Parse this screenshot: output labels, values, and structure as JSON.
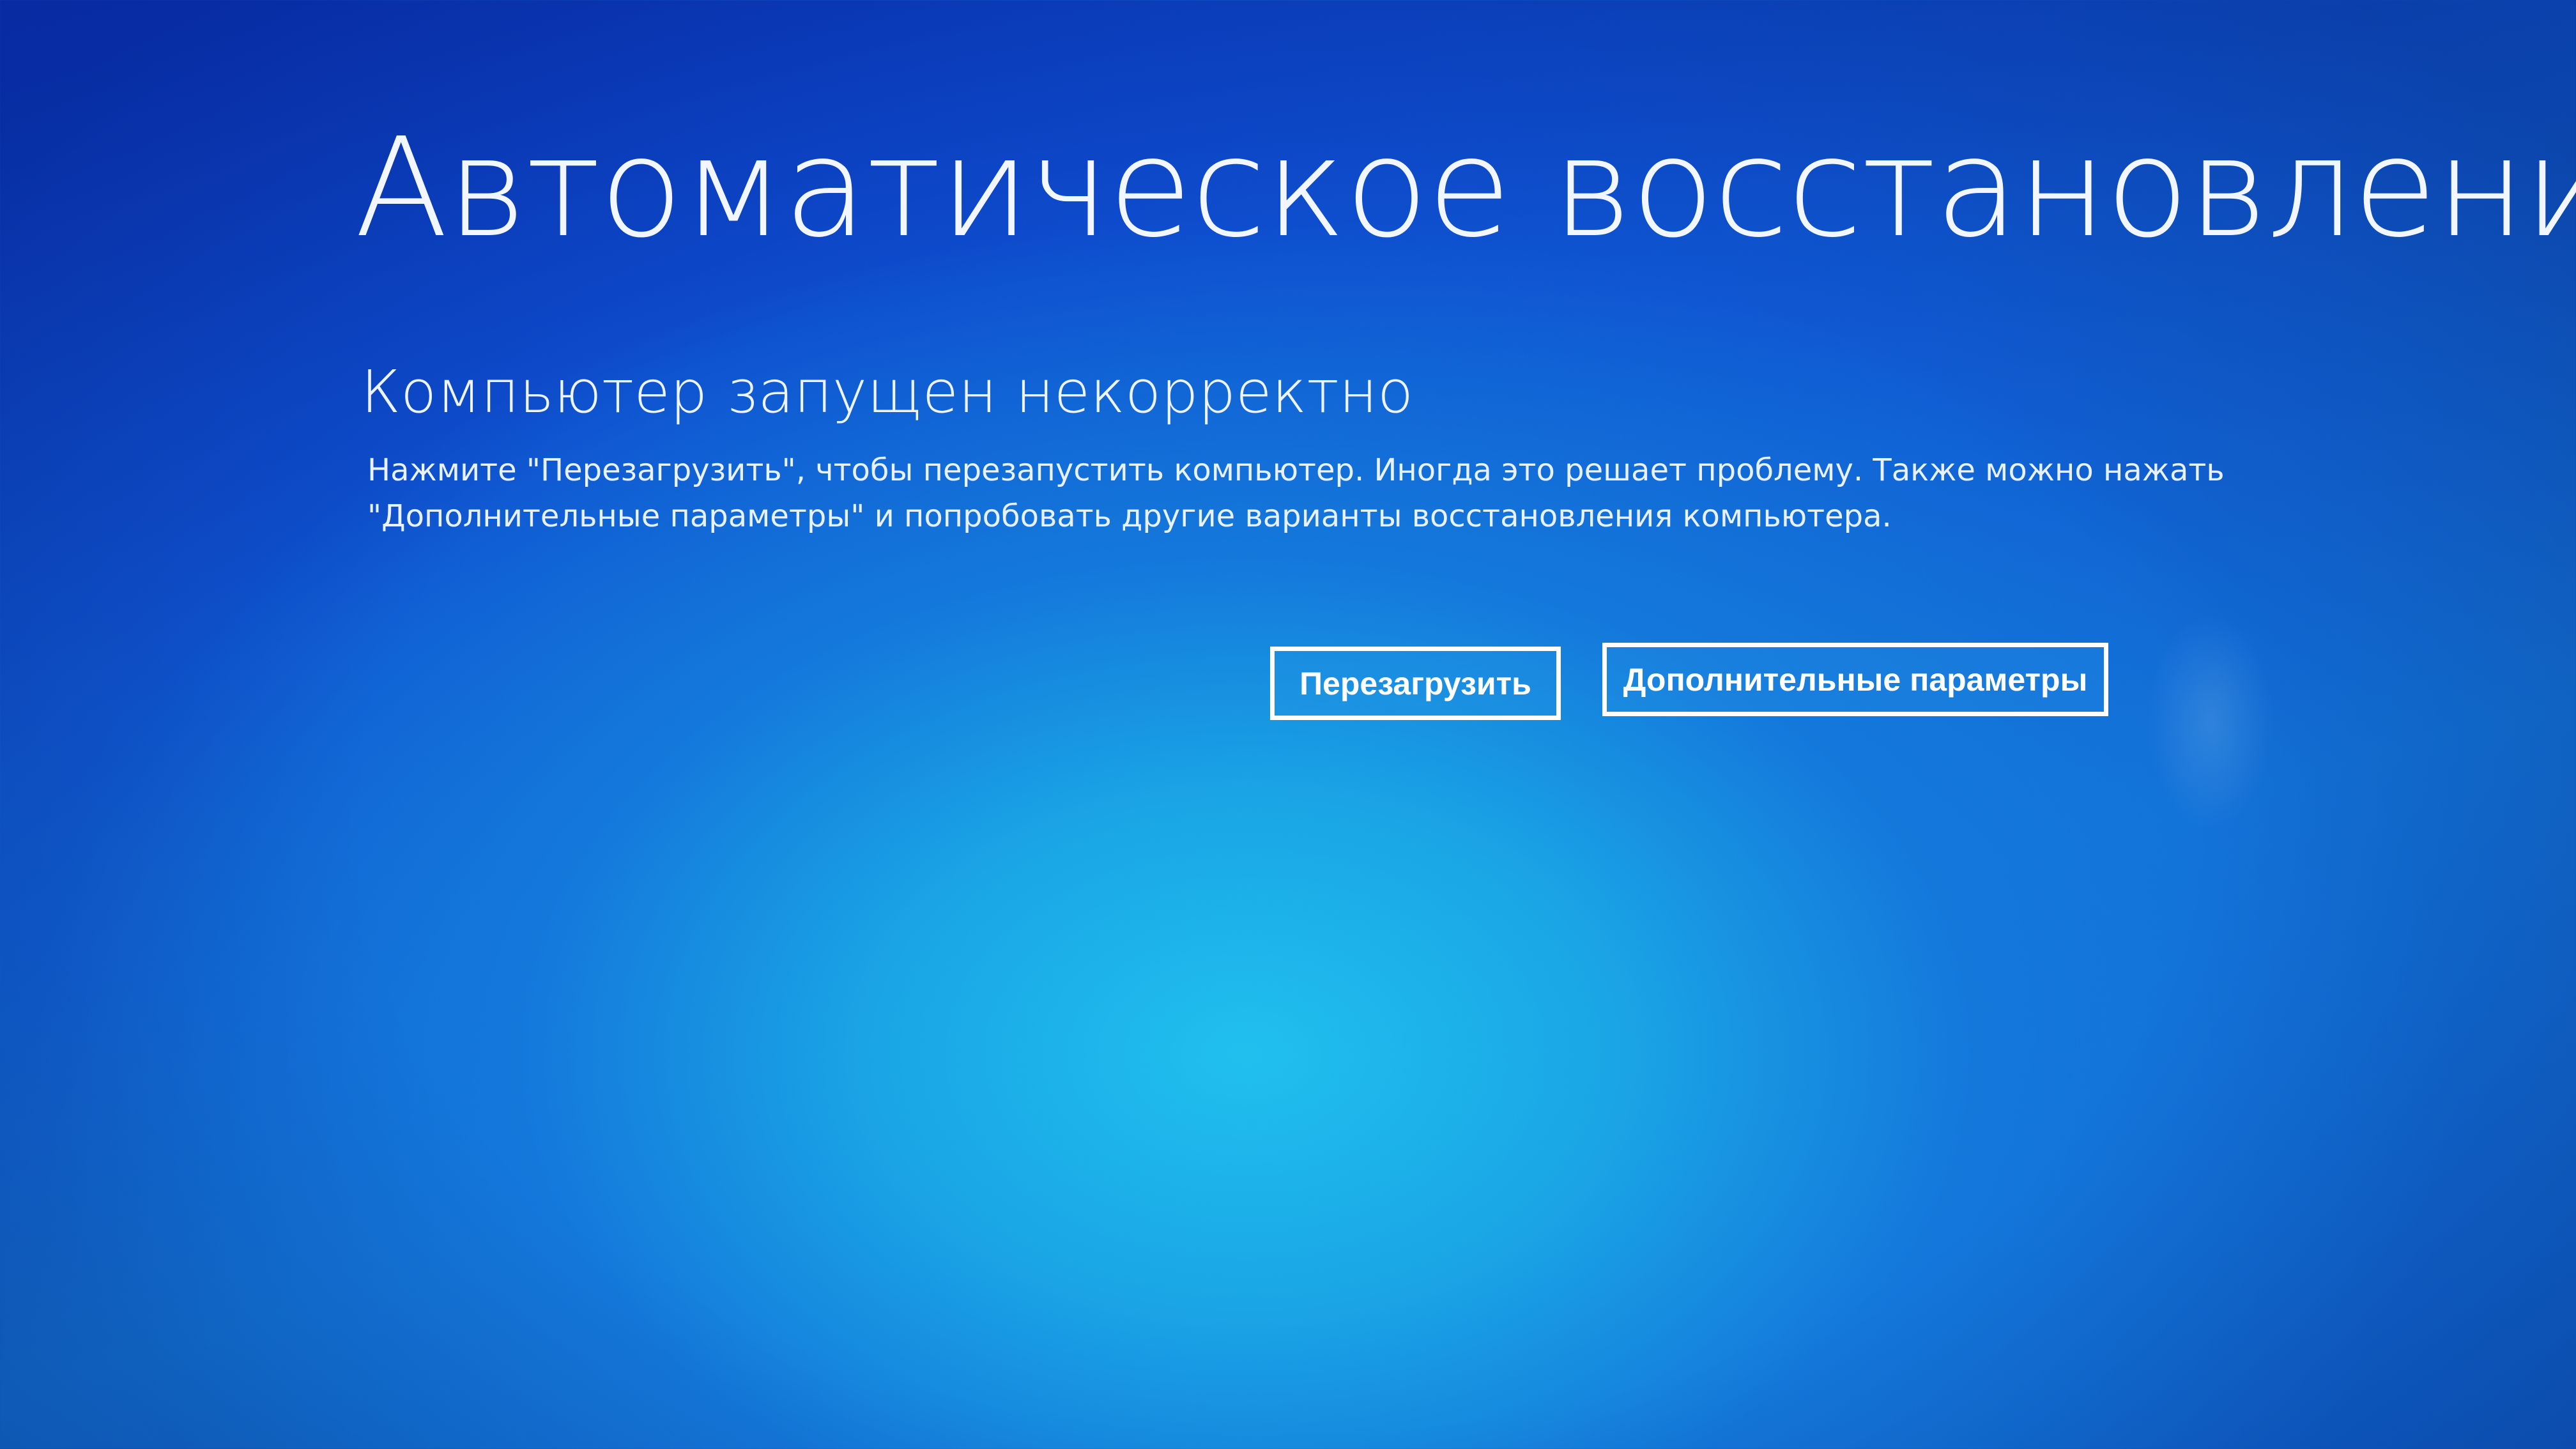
{
  "screen": {
    "title": "Автоматическое восстановление",
    "subtitle": "Компьютер запущен некорректно",
    "description_lines": [
      "Нажмите \"Перезагрузить\", чтобы перезапустить компьютер. Иногда это решает проблему. Также можно нажать",
      "\"Дополнительные параметры\" и попробовать другие варианты восстановления компьютера."
    ]
  },
  "buttons": {
    "restart_label": "Перезагрузить",
    "advanced_label": "Дополнительные параметры"
  },
  "colors": {
    "background_top": "#0a35c4",
    "background_center": "#20c0ee",
    "text": "#ffffff",
    "button_border": "#ffffff"
  }
}
